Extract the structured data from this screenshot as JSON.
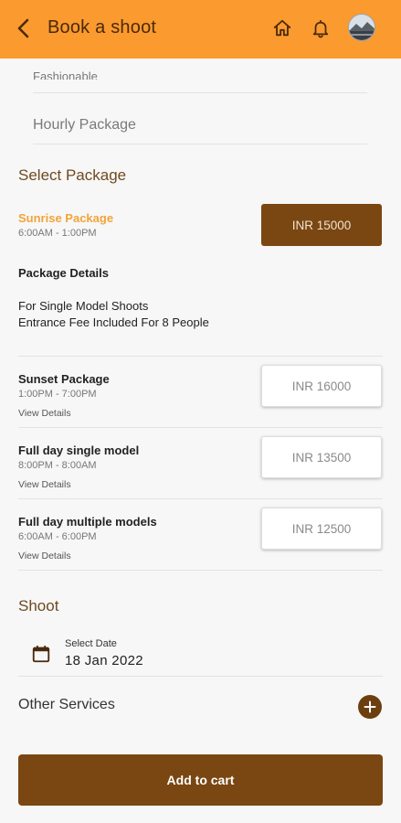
{
  "header": {
    "title": "Book a shoot",
    "back_icon": "chevron-left-icon",
    "home_icon": "home-icon",
    "bell_icon": "bell-icon",
    "bg_color": "#fb9a2e"
  },
  "booking_types": {
    "partial_label": "Fashionable",
    "hourly_label": "Hourly Package"
  },
  "select_package": {
    "heading": "Select Package",
    "selected": {
      "name": "Sunrise Package",
      "time": "6:00AM - 1:00PM",
      "price": "INR 15000",
      "details_title": "Package Details",
      "details_lines": [
        "For Single Model Shoots",
        "Entrance Fee Included For 8 People"
      ]
    },
    "packages": [
      {
        "name": "Sunset Package",
        "time": "1:00PM - 7:00PM",
        "view": "View Details",
        "price": "INR 16000"
      },
      {
        "name": "Full day single model",
        "time": "8:00PM - 8:00AM",
        "view": "View Details",
        "price": "INR 13500"
      },
      {
        "name": "Full day multiple models",
        "time": "6:00AM - 6:00PM",
        "view": "View Details",
        "price": "INR 12500"
      }
    ]
  },
  "shoot": {
    "heading": "Shoot",
    "date_label": "Select Date",
    "date_value": "18 Jan 2022",
    "calendar_icon": "calendar-icon"
  },
  "other_services": {
    "label": "Other Services",
    "add_icon": "plus-icon"
  },
  "cart": {
    "button_label": "Add to cart",
    "accent_color": "#7a4712"
  }
}
